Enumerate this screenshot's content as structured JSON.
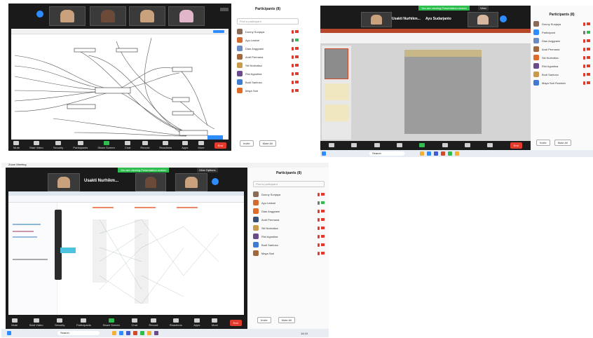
{
  "shot1": {
    "participants_title": "Participants (8)",
    "search_placeholder": "Find a participant",
    "participants": [
      {
        "name": "Donny Sunjaya",
        "color": "#8a6b55",
        "mic": "muted",
        "video": "off"
      },
      {
        "name": "Ayu Lestari",
        "color": "#d36b2f",
        "mic": "on",
        "video": "on"
      },
      {
        "name": "Dian Anggraini",
        "color": "#6a8cc4",
        "mic": "muted",
        "video": "off"
      },
      {
        "name": "Andi Permana",
        "color": "#a2673a",
        "mic": "muted",
        "video": "off"
      },
      {
        "name": "Siti Nurhaliza",
        "color": "#c99a4b",
        "mic": "muted",
        "video": "off"
      },
      {
        "name": "Rini Agustina",
        "color": "#6b4a8c",
        "mic": "muted",
        "video": "off"
      },
      {
        "name": "Budi Santoso",
        "color": "#3e7bd1",
        "mic": "muted",
        "video": "off"
      },
      {
        "name": "Maya Sari",
        "color": "#e06a2a",
        "mic": "muted",
        "video": "off"
      }
    ],
    "invite_label": "Invite",
    "mute_all_label": "Mute All",
    "toolbar": [
      "Mute",
      "Start Video",
      "Security",
      "Participants",
      "Share Screen",
      "Chat",
      "Record",
      "Reactions",
      "Apps",
      "More"
    ],
    "end_label": "End"
  },
  "shot2": {
    "banner": "You are viewing Presentation screen",
    "presenter_label": "Usakti Nurhikm...",
    "presenter2_label": "Ayu Sudarjanto",
    "participants_title": "Participants (8)",
    "participants": [
      {
        "name": "Donny Sunjaya",
        "color": "#8a6b55",
        "mic": "muted",
        "video": "off"
      },
      {
        "name": "Participant",
        "color": "#2d8cff",
        "mic": "on",
        "video": "on"
      },
      {
        "name": "Dian Anggraini",
        "color": "#6a8cc4",
        "mic": "muted",
        "video": "off"
      },
      {
        "name": "Andi Permana",
        "color": "#a2673a",
        "mic": "muted",
        "video": "off"
      },
      {
        "name": "Siti Nurhaliza",
        "color": "#e06a2a",
        "mic": "muted",
        "video": "off"
      },
      {
        "name": "Rini Agustina",
        "color": "#6b4a8c",
        "mic": "muted",
        "video": "off"
      },
      {
        "name": "Budi Santoso",
        "color": "#c99a4b",
        "mic": "muted",
        "video": "off"
      },
      {
        "name": "Maya Sari Rosidah",
        "color": "#3e7bd1",
        "mic": "muted",
        "video": "off"
      }
    ],
    "invite_label": "Invite",
    "mute_all_label": "Mute All",
    "end_label": "End",
    "search_text": "Search"
  },
  "shot3": {
    "window_title": "Zoom Meeting",
    "banner": "You are viewing Presentation screen",
    "view_options": "View Options",
    "presenter_label": "Usakti Nurhikm...",
    "participants_title": "Participants (8)",
    "search_placeholder": "Find a participant",
    "participants": [
      {
        "name": "Donny Sunjaya",
        "color": "#8a6b55",
        "mic": "muted",
        "video": "off"
      },
      {
        "name": "Ayu Lestari",
        "color": "#d36b2f",
        "mic": "on",
        "video": "on"
      },
      {
        "name": "Dian Anggraini",
        "color": "#e06a2a",
        "mic": "muted",
        "video": "off"
      },
      {
        "name": "Andi Permana",
        "color": "#3a4e7a",
        "mic": "muted",
        "video": "off"
      },
      {
        "name": "Siti Nurhaliza",
        "color": "#c99a4b",
        "mic": "muted",
        "video": "off"
      },
      {
        "name": "Rini Agustina",
        "color": "#6b4a8c",
        "mic": "muted",
        "video": "off"
      },
      {
        "name": "Budi Santoso",
        "color": "#3e7bd1",
        "mic": "muted",
        "video": "off"
      },
      {
        "name": "Maya Sari",
        "color": "#a2673a",
        "mic": "muted",
        "video": "off"
      }
    ],
    "invite_label": "Invite",
    "mute_all_label": "Mute All",
    "toolbar": [
      "Mute",
      "Start Video",
      "Security",
      "Participants",
      "Share Screen",
      "Chat",
      "Record",
      "Reactions",
      "Apps",
      "More"
    ],
    "end_label": "End",
    "search_text": "Search",
    "clock": "14:10"
  }
}
